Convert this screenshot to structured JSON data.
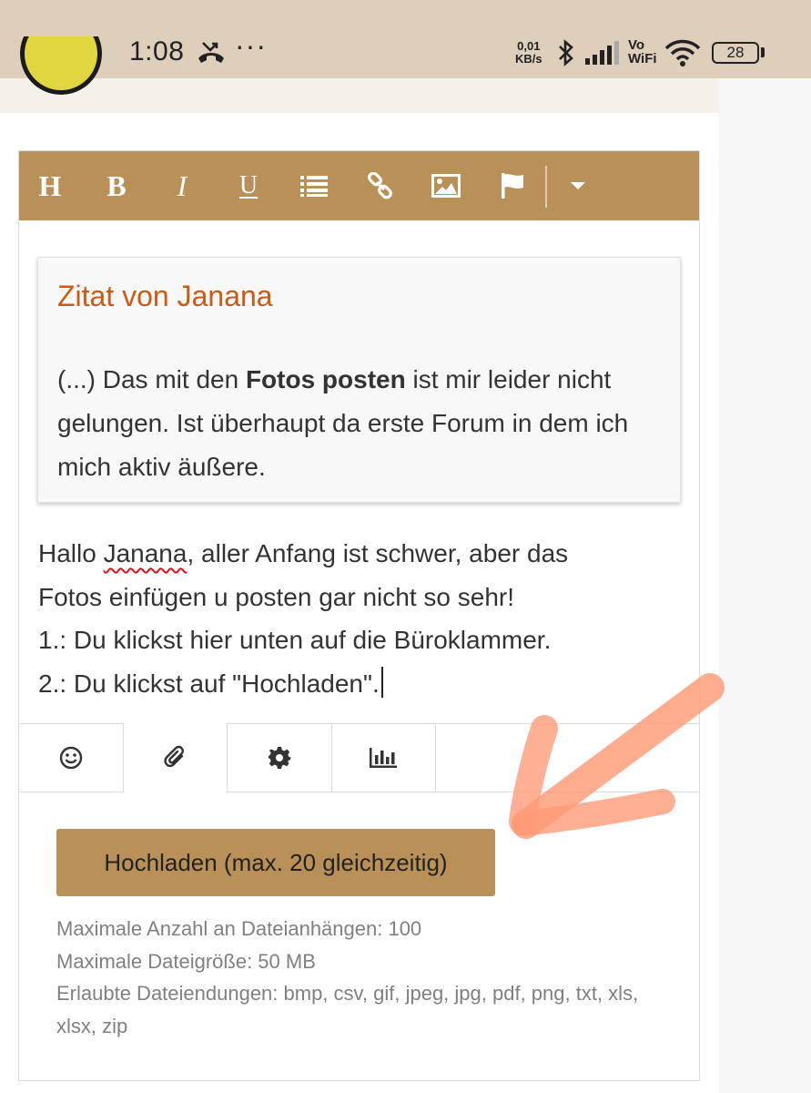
{
  "status_bar": {
    "time": "1:08",
    "dots": "···",
    "speed_value": "0,01",
    "speed_unit": "KB/s",
    "vowifi_top": "Vo",
    "vowifi_bottom": "WiFi",
    "battery": "28",
    "icons": [
      "missed-call-icon",
      "bluetooth-icon",
      "signal-icon",
      "wifi-icon",
      "battery-icon"
    ]
  },
  "toolbar": {
    "heading_label": "H",
    "bold_label": "B",
    "italic_label": "I",
    "underline_label": "U",
    "icons": [
      "list-icon",
      "link-icon",
      "image-icon",
      "flag-icon",
      "dropdown-caret-icon"
    ]
  },
  "quote": {
    "title": "Zitat von Janana",
    "text_before": "(...) Das mit den ",
    "text_bold": "Fotos posten",
    "text_after": " ist mir leider nicht gelungen. Ist überhaupt da erste Forum in dem ich mich aktiv äußere."
  },
  "message": {
    "line1_prefix": "Hallo ",
    "line1_name": "Janana",
    "line1_suffix": ", aller Anfang ist schwer, aber das",
    "line2": "Fotos einfügen u posten gar nicht so sehr!",
    "line3": "1.: Du klickst hier unten auf die Büroklammer.",
    "line4": "2.: Du klickst auf \"Hochladen\"."
  },
  "tabs": {
    "icons": [
      "smiley-icon",
      "paperclip-icon",
      "gear-icon",
      "poll-chart-icon"
    ],
    "active": "paperclip-icon"
  },
  "upload": {
    "button_label": "Hochladen (max. 20 gleichzeitig)",
    "max_count": "Maximale Anzahl an Dateianhängen: 100",
    "max_size": "Maximale Dateigröße: 50 MB",
    "extensions": "Erlaubte Dateiendungen: bmp, csv, gif, jpeg, jpg, pdf, png, txt, xls, xlsx, zip"
  },
  "colors": {
    "accent": "#b99158",
    "quote_title": "#cc5a14",
    "status_bar": "#ddcfba",
    "annotation_arrow": "#ff9a76"
  }
}
